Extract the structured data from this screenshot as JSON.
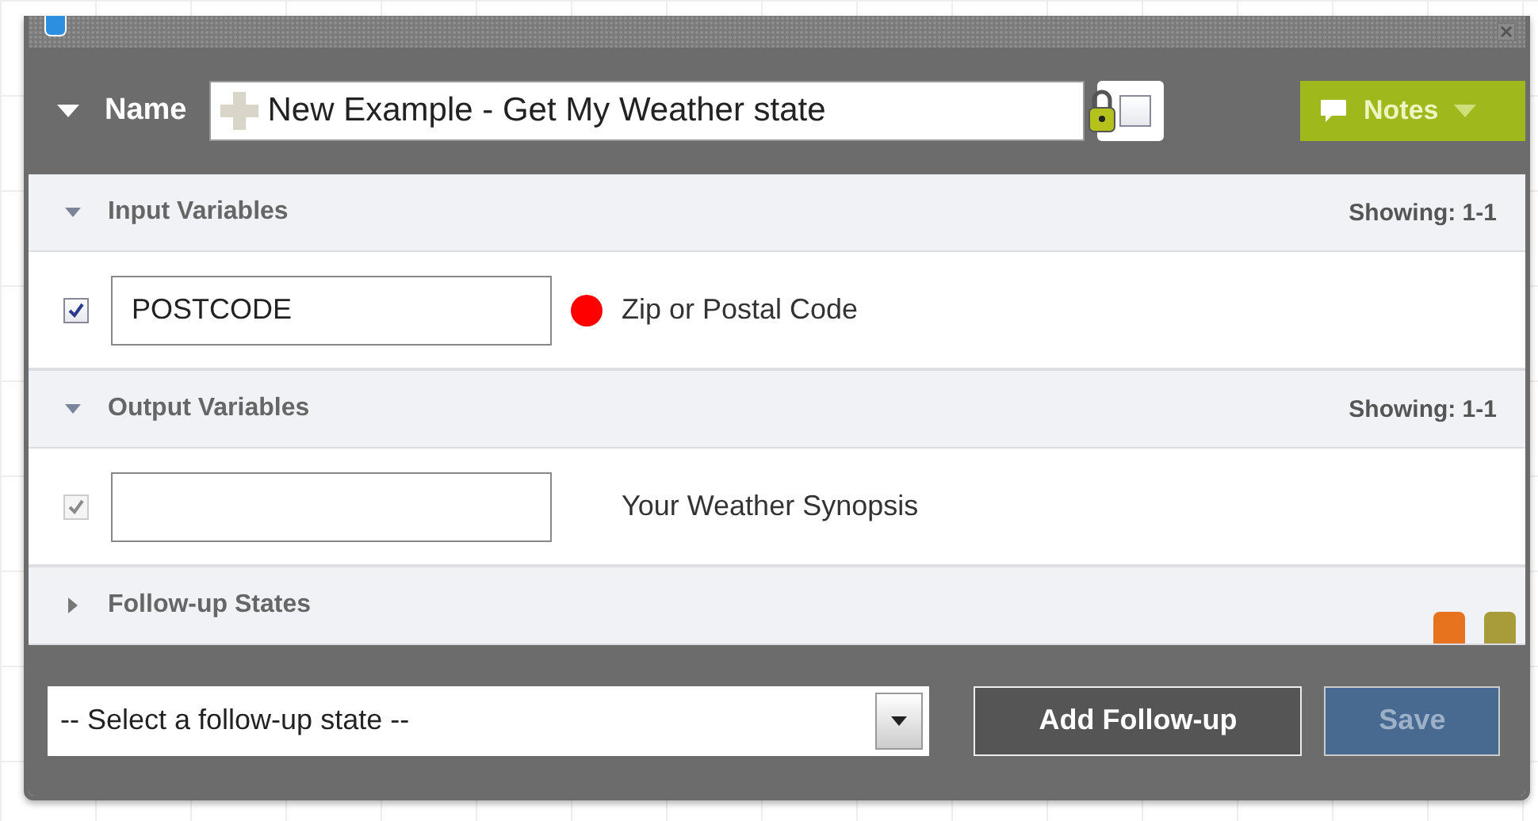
{
  "header": {
    "expanded": true,
    "label": "Name",
    "value": "New Example - Get My Weather state",
    "lock_checked": false,
    "notes": "Notes"
  },
  "sections": [
    {
      "title": "Input Variables",
      "expanded": true,
      "showing": "Showing: 1-1",
      "rows": [
        {
          "checked": true,
          "disabled": false,
          "value": "POSTCODE",
          "required": true,
          "description": "Zip or Postal Code"
        }
      ]
    },
    {
      "title": "Output Variables",
      "expanded": true,
      "showing": "Showing: 1-1",
      "rows": [
        {
          "checked": true,
          "disabled": true,
          "required": false,
          "description": "Your Weather Synopsis"
        }
      ]
    },
    {
      "title": "Follow-up States",
      "expanded": false,
      "swatches": [
        {
          "color": "#e8731e"
        },
        {
          "color": "#a89c3a"
        }
      ]
    }
  ],
  "footer": {
    "select_value": "-- Select a follow-up state --",
    "add_button": "Add Follow-up",
    "save_button": "Save",
    "save_disabled": true
  }
}
